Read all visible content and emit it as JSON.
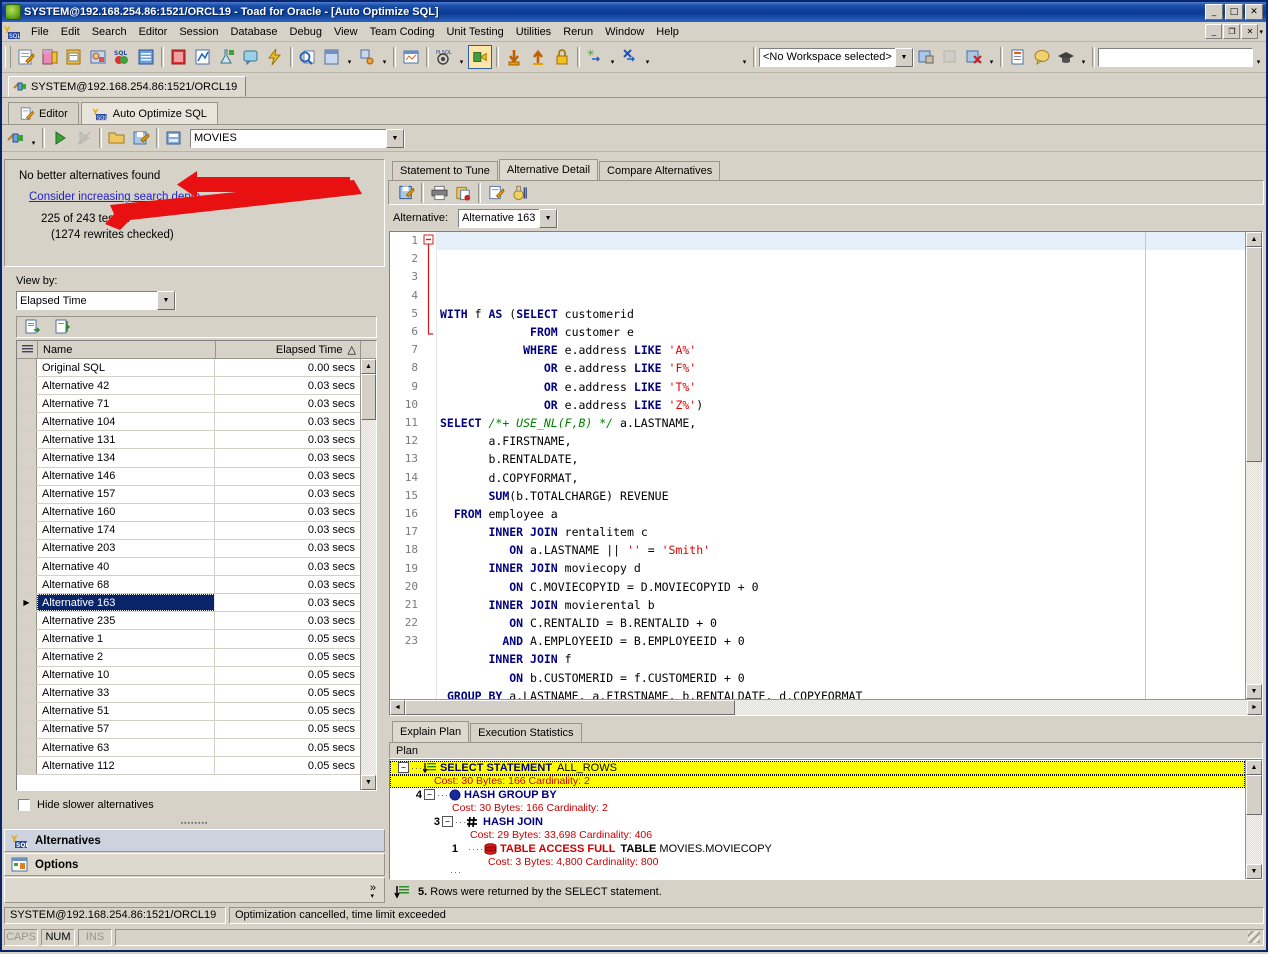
{
  "window": {
    "title": "SYSTEM@192.168.254.86:1521/ORCL19 - Toad for Oracle - [Auto Optimize SQL]",
    "minimize": "_",
    "maximize": "□",
    "close": "✕",
    "mdi_minimize": "_",
    "mdi_restore": "❐",
    "mdi_close": "✕",
    "mdi_more": "▾"
  },
  "menu": {
    "items": [
      "File",
      "Edit",
      "Search",
      "Editor",
      "Session",
      "Database",
      "Debug",
      "View",
      "Team Coding",
      "Unit Testing",
      "Utilities",
      "Rerun",
      "Window",
      "Help"
    ]
  },
  "toolbar": {
    "workspace_value": "<No Workspace selected>",
    "search_value": ""
  },
  "connection_tab": {
    "label": "SYSTEM@192.168.254.86:1521/ORCL19"
  },
  "editor_tabs": [
    {
      "label": "Editor",
      "active": false
    },
    {
      "label": "Auto Optimize SQL",
      "active": true
    }
  ],
  "schema_select": {
    "value": "MOVIES"
  },
  "summary": {
    "headline": "No better alternatives found",
    "link": "Consider increasing search depth",
    "tested": "225 of 243 tested",
    "rewrites": "(1274 rewrites checked)"
  },
  "view_by": {
    "label": "View by:",
    "value": "Elapsed Time"
  },
  "grid": {
    "columns": [
      "Name",
      "Elapsed Time"
    ],
    "sort_indicator": "△",
    "rows": [
      {
        "name": "Original SQL",
        "time": "0.00 secs",
        "selected": false
      },
      {
        "name": "Alternative 42",
        "time": "0.03 secs",
        "selected": false
      },
      {
        "name": "Alternative 71",
        "time": "0.03 secs",
        "selected": false
      },
      {
        "name": "Alternative 104",
        "time": "0.03 secs",
        "selected": false
      },
      {
        "name": "Alternative 131",
        "time": "0.03 secs",
        "selected": false
      },
      {
        "name": "Alternative 134",
        "time": "0.03 secs",
        "selected": false
      },
      {
        "name": "Alternative 146",
        "time": "0.03 secs",
        "selected": false
      },
      {
        "name": "Alternative 157",
        "time": "0.03 secs",
        "selected": false
      },
      {
        "name": "Alternative 160",
        "time": "0.03 secs",
        "selected": false
      },
      {
        "name": "Alternative 174",
        "time": "0.03 secs",
        "selected": false
      },
      {
        "name": "Alternative 203",
        "time": "0.03 secs",
        "selected": false
      },
      {
        "name": "Alternative 40",
        "time": "0.03 secs",
        "selected": false
      },
      {
        "name": "Alternative 68",
        "time": "0.03 secs",
        "selected": false
      },
      {
        "name": "Alternative 163",
        "time": "0.03 secs",
        "selected": true
      },
      {
        "name": "Alternative 235",
        "time": "0.03 secs",
        "selected": false
      },
      {
        "name": "Alternative 1",
        "time": "0.05 secs",
        "selected": false
      },
      {
        "name": "Alternative 2",
        "time": "0.05 secs",
        "selected": false
      },
      {
        "name": "Alternative 10",
        "time": "0.05 secs",
        "selected": false
      },
      {
        "name": "Alternative 33",
        "time": "0.05 secs",
        "selected": false
      },
      {
        "name": "Alternative 51",
        "time": "0.05 secs",
        "selected": false
      },
      {
        "name": "Alternative 57",
        "time": "0.05 secs",
        "selected": false
      },
      {
        "name": "Alternative 63",
        "time": "0.05 secs",
        "selected": false
      },
      {
        "name": "Alternative 112",
        "time": "0.05 secs",
        "selected": false
      }
    ]
  },
  "hide_slower": {
    "label": "Hide slower alternatives",
    "checked": false
  },
  "nav_buttons": [
    {
      "label": "Alternatives",
      "active": true
    },
    {
      "label": "Options",
      "active": false
    }
  ],
  "nav_overflow": {
    "chevron": "»",
    "caret": "▾"
  },
  "right_tabs": [
    {
      "label": "Statement to Tune",
      "active": false
    },
    {
      "label": "Alternative Detail",
      "active": true
    },
    {
      "label": "Compare Alternatives",
      "active": false
    }
  ],
  "alternative_picker": {
    "label": "Alternative:",
    "value": "Alternative 163"
  },
  "sql": {
    "line_count": 23,
    "lines": [
      "WITH f AS (SELECT customerid",
      "             FROM customer e",
      "            WHERE e.address LIKE 'A%'",
      "               OR e.address LIKE 'F%'",
      "               OR e.address LIKE 'T%'",
      "               OR e.address LIKE 'Z%')",
      "SELECT /*+ USE_NL(F,B) */ a.LASTNAME,",
      "       a.FIRSTNAME,",
      "       b.RENTALDATE,",
      "       d.COPYFORMAT,",
      "       SUM(b.TOTALCHARGE) REVENUE",
      "  FROM employee a",
      "       INNER JOIN rentalitem c",
      "          ON a.LASTNAME || '' = 'Smith'",
      "       INNER JOIN moviecopy d",
      "          ON C.MOVIECOPYID = D.MOVIECOPYID + 0",
      "       INNER JOIN movierental b",
      "          ON C.RENTALID = B.RENTALID + 0",
      "         AND A.EMPLOYEEID = B.EMPLOYEEID + 0",
      "       INNER JOIN f",
      "          ON b.CUSTOMERID = f.CUSTOMERID + 0",
      " GROUP BY a.LASTNAME, a.FIRSTNAME, b.RENTALDATE, d.COPYFORMAT",
      ""
    ]
  },
  "bottom_tabs": [
    {
      "label": "Explain Plan",
      "active": true
    },
    {
      "label": "Execution Statistics",
      "active": false
    }
  ],
  "plan": {
    "header": "Plan",
    "rows": [
      {
        "num": "",
        "op": "SELECT STATEMENT",
        "extra": "ALL_ROWS",
        "cost": "Cost: 30  Bytes: 166  Cardinality: 2",
        "indent": 0,
        "selected": true,
        "icon": "select-statement-icon",
        "expander": "−"
      },
      {
        "num": "4",
        "op": "HASH GROUP BY",
        "extra": "",
        "cost": "Cost: 30  Bytes: 166  Cardinality: 2",
        "indent": 1,
        "selected": false,
        "icon": "hash-group-by-icon",
        "expander": "−"
      },
      {
        "num": "3",
        "op": "HASH JOIN",
        "extra": "",
        "cost": "Cost: 29  Bytes: 33,698  Cardinality: 406",
        "indent": 2,
        "selected": false,
        "icon": "hash-join-icon",
        "expander": "−"
      },
      {
        "num": "1",
        "op": "TABLE ACCESS FULL",
        "extra": "TABLE MOVIES.MOVIECOPY",
        "cost": "Cost: 3  Bytes: 4,800  Cardinality: 800",
        "indent": 3,
        "selected": false,
        "icon": "table-icon",
        "expander": ""
      }
    ],
    "footnote": "5. Rows were returned by the SELECT statement.",
    "footnote_num": "5."
  },
  "status": {
    "connection": "SYSTEM@192.168.254.86:1521/ORCL19",
    "message": "Optimization cancelled, time limit exceeded",
    "caps": "CAPS",
    "num": "NUM",
    "ins": "INS"
  },
  "colors": {
    "titlebar": "#0a3a93",
    "face": "#d6d2c8",
    "selection": "#0a246a",
    "plan_highlight": "#ffff00",
    "link": "#2222cc",
    "annotation_arrow": "#e00000",
    "keyword": "#000080",
    "string": "#e00000",
    "comment": "#008000",
    "cost_text": "#cc0000"
  }
}
